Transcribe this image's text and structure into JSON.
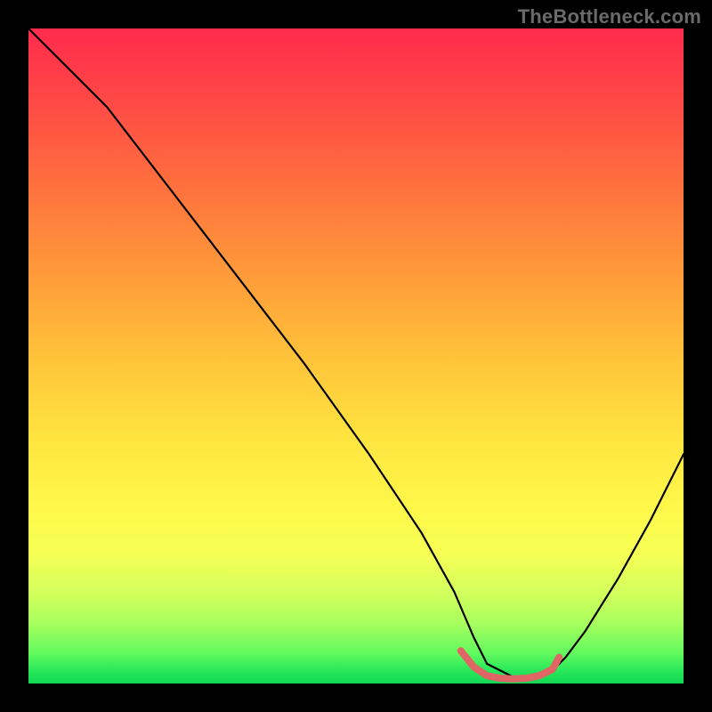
{
  "watermark": "TheBottleneck.com",
  "chart_data": {
    "type": "line",
    "title": "",
    "xlabel": "",
    "ylabel": "",
    "xlim": [
      0,
      100
    ],
    "ylim": [
      0,
      100
    ],
    "grid": false,
    "legend": false,
    "series": [
      {
        "name": "bottleneck-curve",
        "color": "#000000",
        "x": [
          0,
          5,
          12,
          22,
          32,
          42,
          52,
          60,
          65,
          68,
          70,
          74,
          78,
          80,
          82,
          85,
          90,
          95,
          100
        ],
        "values": [
          100,
          95,
          88,
          75,
          62,
          49,
          35,
          23,
          14,
          7,
          3,
          1,
          1,
          2,
          4,
          8,
          16,
          25,
          35
        ]
      },
      {
        "name": "optimal-range-marker",
        "color": "#e06666",
        "x": [
          66,
          68,
          70,
          72,
          74,
          76,
          78,
          80,
          81
        ],
        "values": [
          5,
          2.5,
          1.2,
          0.8,
          0.7,
          0.8,
          1.2,
          2.2,
          4
        ]
      }
    ],
    "background_gradient": {
      "stops": [
        {
          "pos": 0.0,
          "color": "#ff2b4d"
        },
        {
          "pos": 0.08,
          "color": "#ff4048"
        },
        {
          "pos": 0.22,
          "color": "#ff6a3f"
        },
        {
          "pos": 0.36,
          "color": "#ff963a"
        },
        {
          "pos": 0.5,
          "color": "#ffc23a"
        },
        {
          "pos": 0.62,
          "color": "#ffe33f"
        },
        {
          "pos": 0.73,
          "color": "#fff84a"
        },
        {
          "pos": 0.8,
          "color": "#f8ff55"
        },
        {
          "pos": 0.86,
          "color": "#d4ff5c"
        },
        {
          "pos": 0.91,
          "color": "#a5ff5e"
        },
        {
          "pos": 0.955,
          "color": "#60f95e"
        },
        {
          "pos": 0.98,
          "color": "#29e85a"
        },
        {
          "pos": 1.0,
          "color": "#12d755"
        }
      ]
    }
  }
}
